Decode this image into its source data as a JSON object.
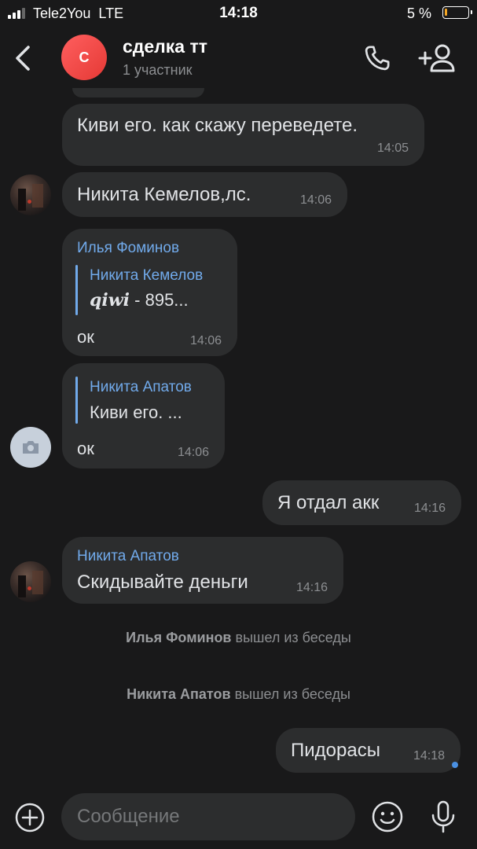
{
  "status": {
    "carrier": "Tele2You",
    "network": "LTE",
    "time": "14:18",
    "battery": "5 %"
  },
  "header": {
    "avatar_letter": "С",
    "title": "сделка тт",
    "subtitle": "1 участник"
  },
  "messages": [
    {
      "text": "Киви его. как скажу переведете.",
      "time": "14:05"
    },
    {
      "text": "Никита Кемелов,лс.",
      "time": "14:06"
    },
    {
      "sender": "Илья Фоминов",
      "quote_author": "Никита Кемелов",
      "quote_brand": "qiwi",
      "quote_text": " - 895...",
      "text": "ок",
      "time": "14:06"
    },
    {
      "quote_author": "Никита Апатов",
      "quote_text": "Киви его. ...",
      "text": "ок",
      "time": "14:06"
    },
    {
      "text": "Я отдал акк",
      "time": "14:16"
    },
    {
      "sender": "Никита Апатов",
      "text": "Скидывайте деньги",
      "time": "14:16"
    },
    {
      "text": "Пидорасы",
      "time": "14:18"
    }
  ],
  "system": [
    {
      "name": "Илья Фоминов",
      "action": " вышел из беседы"
    },
    {
      "name": "Никита Апатов",
      "action": " вышел из беседы"
    }
  ],
  "composer": {
    "placeholder": "Сообщение"
  },
  "colors": {
    "background": "#19191a",
    "bubble": "#2c2d2e",
    "accent": "#71aaeb",
    "avatar": "#e53935"
  },
  "icons": [
    "back-icon",
    "phone-icon",
    "add-user-icon",
    "camera-icon",
    "plus-icon",
    "smile-icon",
    "mic-icon"
  ]
}
